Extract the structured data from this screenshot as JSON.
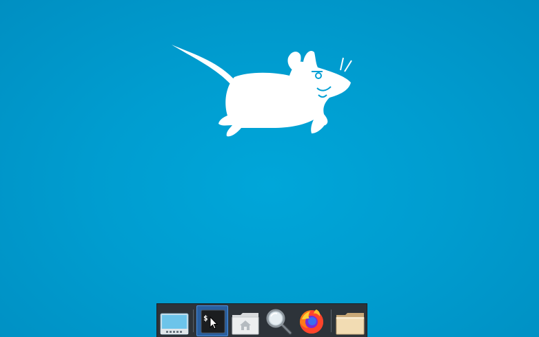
{
  "desktop": {
    "background_color": "#009fd4",
    "logo": "xfce-mouse-logo"
  },
  "dock": {
    "background_color": "#2d3339",
    "items": [
      {
        "icon": "show-desktop-icon",
        "active": false
      },
      {
        "icon": "separator"
      },
      {
        "icon": "terminal-icon",
        "active": true,
        "label": "$"
      },
      {
        "icon": "home-folder-icon",
        "active": false
      },
      {
        "icon": "search-icon",
        "active": false
      },
      {
        "icon": "firefox-icon",
        "active": false
      },
      {
        "icon": "separator"
      },
      {
        "icon": "folder-icon",
        "active": false
      }
    ]
  },
  "cursor": {
    "icon": "mouse-pointer-icon"
  }
}
